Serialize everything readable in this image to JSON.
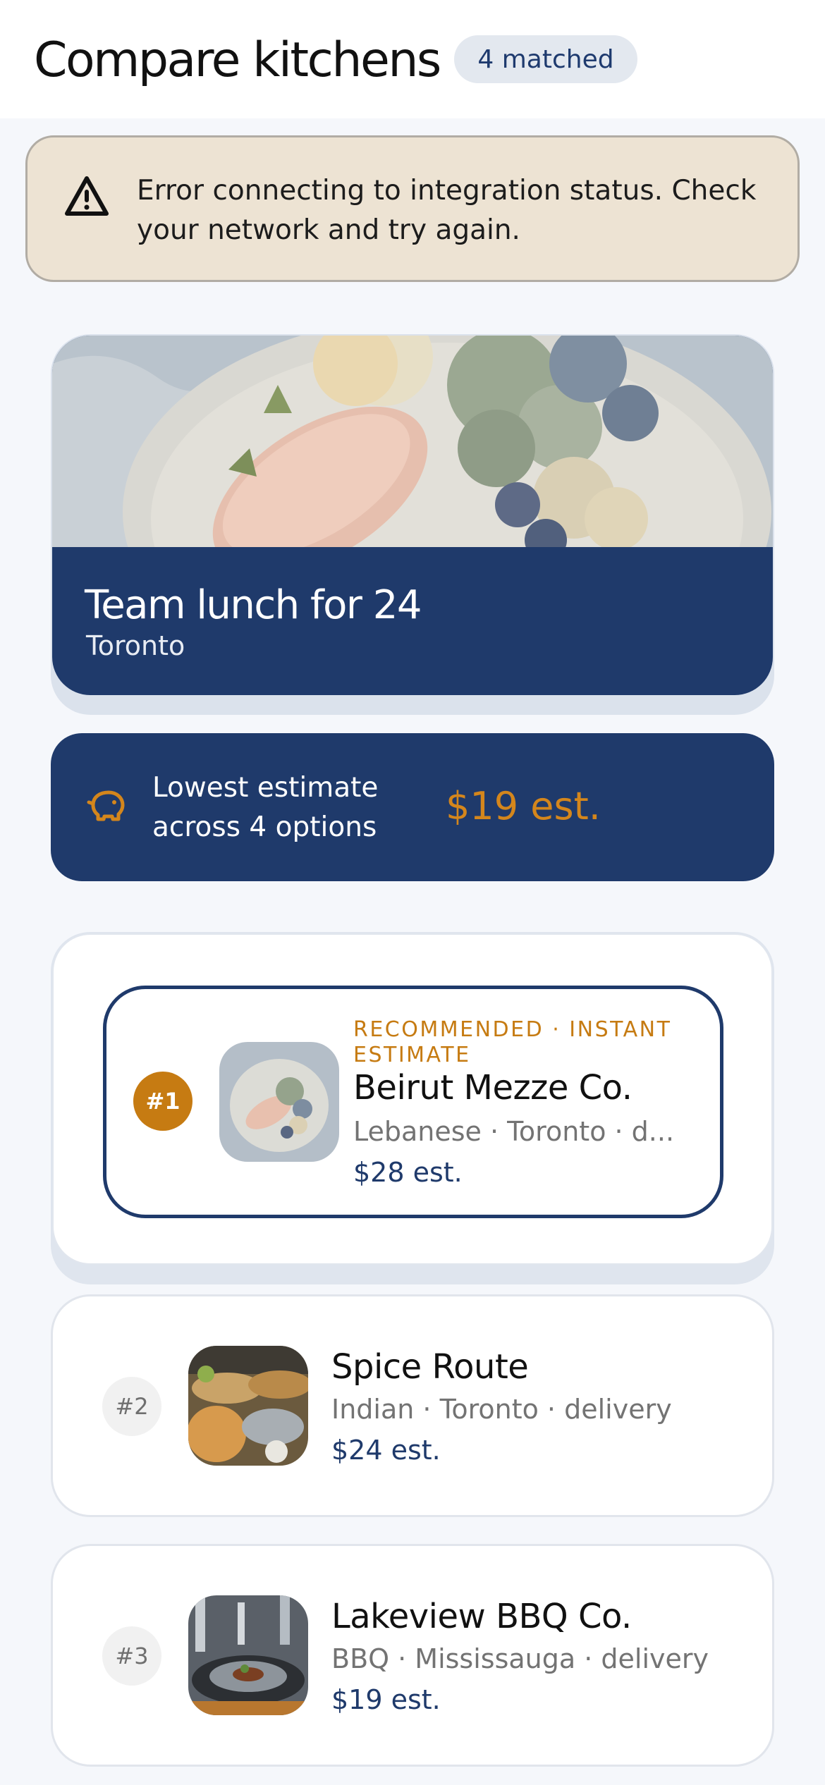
{
  "header": {
    "title": "Compare kitchens",
    "matched_badge": "4 matched"
  },
  "error_banner": {
    "icon": "warning-triangle-icon",
    "message": "Error connecting to integration status. Check your network and try again."
  },
  "hero": {
    "title": "Team lunch for 24",
    "location": "Toronto"
  },
  "estimate_summary": {
    "icon": "piggy-bank-icon",
    "label": "Lowest estimate across 4 options",
    "value": "$19 est."
  },
  "kitchens": [
    {
      "rank": "#1",
      "tag": "RECOMMENDED · INSTANT ESTIMATE",
      "name": "Beirut Mezze Co.",
      "meta": "Lebanese · Toronto · d...",
      "price": "$28 est."
    },
    {
      "rank": "#2",
      "name": "Spice Route",
      "meta": "Indian · Toronto · delivery",
      "price": "$24 est."
    },
    {
      "rank": "#3",
      "name": "Lakeview BBQ Co.",
      "meta": "BBQ · Mississauga · delivery",
      "price": "$19 est."
    }
  ],
  "colors": {
    "navy": "#1f3a6b",
    "accent_orange": "#c67b12",
    "warning_bg": "#ede3d3",
    "page_bg": "#f5f7fb"
  }
}
